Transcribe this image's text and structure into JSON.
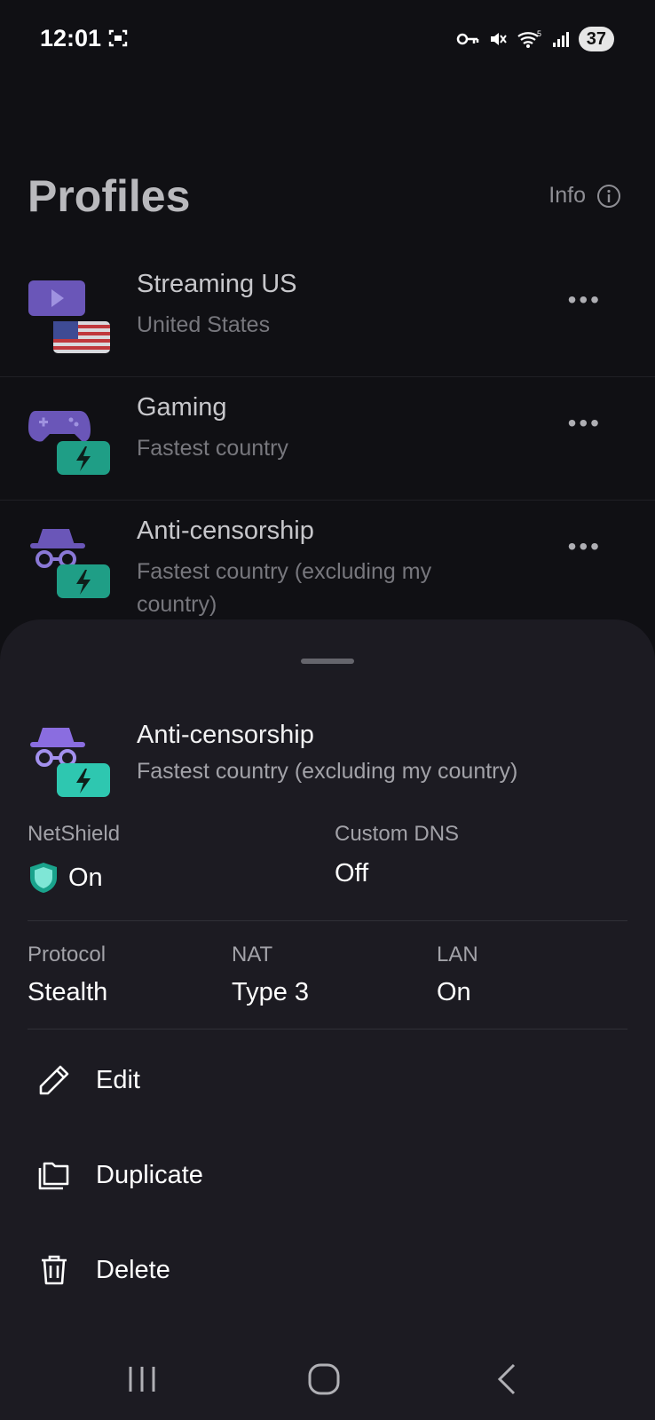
{
  "status_bar": {
    "time": "12:01",
    "battery": "37",
    "icons": [
      "screen-record-icon",
      "vpn-key-icon",
      "mute-icon",
      "wifi-icon",
      "signal-icon"
    ]
  },
  "header": {
    "title": "Profiles",
    "info_label": "Info"
  },
  "profiles": [
    {
      "name": "Streaming US",
      "subtitle": "United States",
      "icon": "streaming-us-flag-icon"
    },
    {
      "name": "Gaming",
      "subtitle": "Fastest country",
      "icon": "gamepad-fastest-icon"
    },
    {
      "name": "Anti-censorship",
      "subtitle": "Fastest country (excluding my country)",
      "icon": "spy-fastest-icon"
    }
  ],
  "sheet": {
    "name": "Anti-censorship",
    "subtitle": "Fastest country (excluding my country)",
    "netshield": {
      "label": "NetShield",
      "value": "On"
    },
    "custom_dns": {
      "label": "Custom DNS",
      "value": "Off"
    },
    "protocol": {
      "label": "Protocol",
      "value": "Stealth"
    },
    "nat": {
      "label": "NAT",
      "value": "Type 3"
    },
    "lan": {
      "label": "LAN",
      "value": "On"
    },
    "actions": {
      "edit": "Edit",
      "duplicate": "Duplicate",
      "delete": "Delete"
    }
  },
  "colors": {
    "background": "#101014",
    "sheet": "#1c1b22",
    "accent_purple": "#8a6de0",
    "accent_teal": "#2ec7b0"
  }
}
